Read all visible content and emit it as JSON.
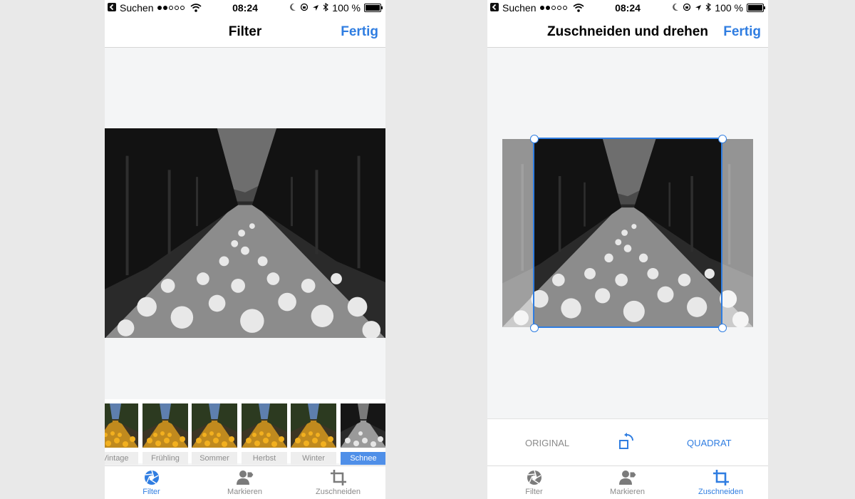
{
  "status_bar": {
    "carrier": "Suchen",
    "time": "08:24",
    "battery": "100 %"
  },
  "left_screen": {
    "title": "Filter",
    "done_label": "Fertig",
    "filters": [
      {
        "label": "Vintage",
        "selected": false
      },
      {
        "label": "Frühling",
        "selected": false
      },
      {
        "label": "Sommer",
        "selected": false
      },
      {
        "label": "Herbst",
        "selected": false
      },
      {
        "label": "Winter",
        "selected": false
      },
      {
        "label": "Schnee",
        "selected": true
      }
    ]
  },
  "right_screen": {
    "title": "Zuschneiden und drehen",
    "done_label": "Fertig",
    "original_label": "ORIGINAL",
    "square_label": "QUADRAT"
  },
  "tabs": [
    {
      "label": "Filter",
      "icon": "aperture-icon"
    },
    {
      "label": "Markieren",
      "icon": "person-tag-icon"
    },
    {
      "label": "Zuschneiden",
      "icon": "crop-icon"
    }
  ],
  "colors": {
    "accent": "#2f7de1",
    "selected_filter": "#4f8fe8",
    "inactive": "#8a8a8a"
  }
}
